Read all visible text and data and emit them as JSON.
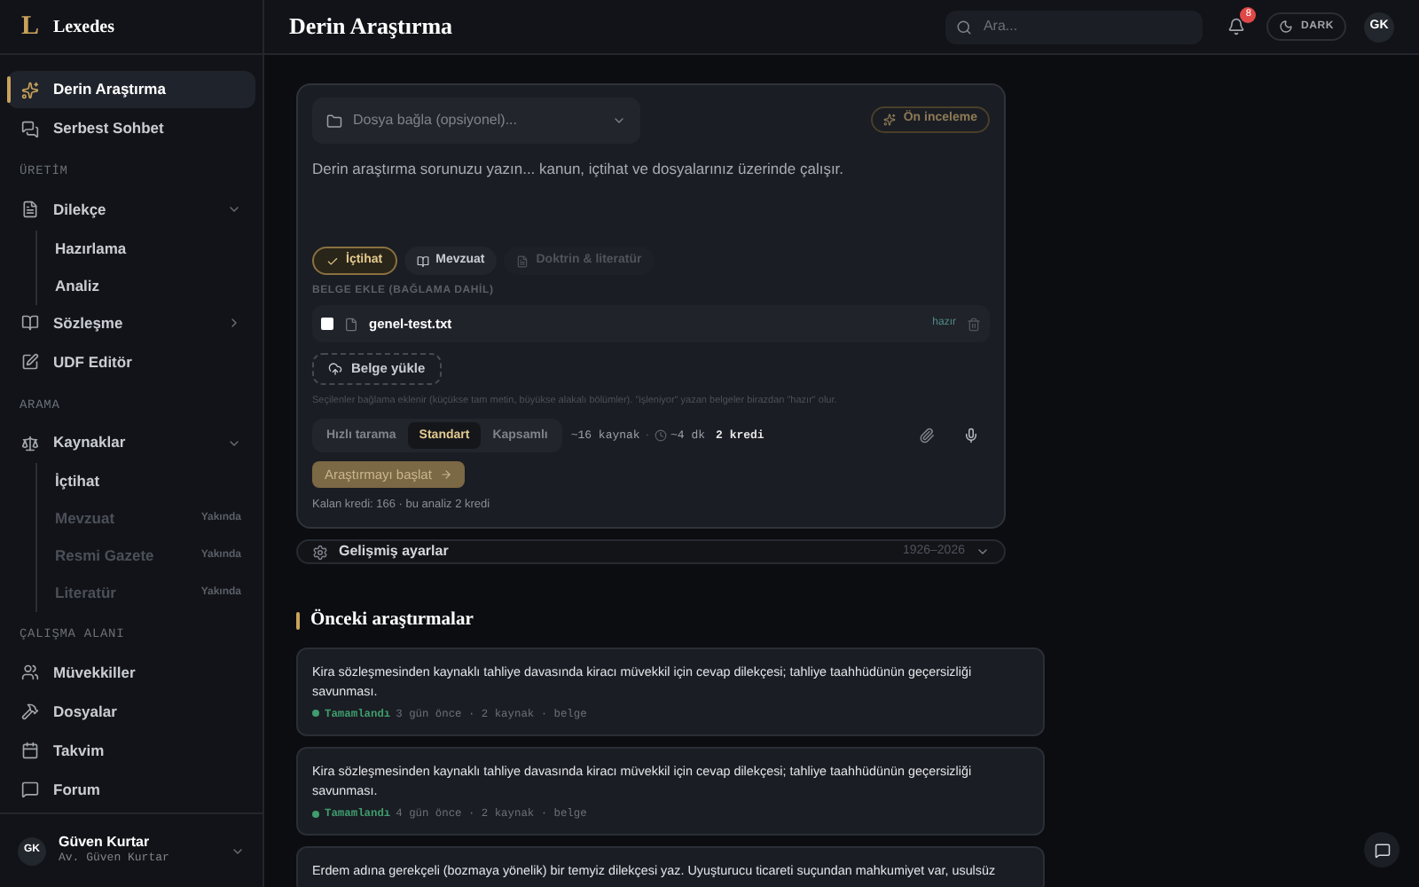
{
  "sidebar": {
    "logo": {
      "mark": "L",
      "name": "Lexedes"
    },
    "groups": [
      {
        "items": [
          {
            "label": "Derin Araştırma",
            "selected": true
          },
          {
            "label": "Serbest Sohbet",
            "selected": false
          }
        ]
      },
      {
        "heading": "ÜRETİM",
        "items": [
          {
            "label": "Dilekçe",
            "selected": false,
            "expanded": true,
            "children": [
              {
                "label": "Hazırlama",
                "disabled": false
              },
              {
                "label": "Analiz",
                "disabled": false
              }
            ]
          },
          {
            "label": "Sözleşme",
            "selected": false,
            "expanded": false
          },
          {
            "label": "UDF Editör",
            "selected": false
          }
        ]
      },
      {
        "heading": "ARAMA",
        "items": [
          {
            "label": "Kaynaklar",
            "selected": false,
            "expanded": true,
            "children": [
              {
                "label": "İçtihat",
                "disabled": false
              },
              {
                "label": "Mevzuat",
                "disabled": true,
                "badge": "Yakında"
              },
              {
                "label": "Resmi Gazete",
                "disabled": true,
                "badge": "Yakında"
              },
              {
                "label": "Literatür",
                "disabled": true,
                "badge": "Yakında"
              }
            ]
          }
        ]
      },
      {
        "heading": "ÇALIŞMA ALANI",
        "items": [
          {
            "label": "Müvekkiller",
            "selected": false
          },
          {
            "label": "Dosyalar",
            "selected": false
          },
          {
            "label": "Takvim",
            "selected": false
          },
          {
            "label": "Forum",
            "selected": false
          }
        ]
      }
    ],
    "user": {
      "initials": "GK",
      "name": "Güven Kurtar",
      "subtitle": "Av. Güven Kurtar"
    }
  },
  "header": {
    "title": "Derin Araştırma",
    "search": {
      "placeholder": "Ara..."
    },
    "notifications": "8",
    "theme": "DARK",
    "avatar": "GK"
  },
  "composer": {
    "attach": {
      "placeholder": "Dosya bağla (opsiyonel)..."
    },
    "preview": "Ön inceleme",
    "prompt": {
      "placeholder": "Derin araştırma sorunuzu yazın... kanun, içtihat ve dosyalarınız üzerinde çalışır."
    },
    "sources": [
      {
        "label": "İçtihat",
        "selected": true,
        "disabled": false
      },
      {
        "label": "Mevzuat",
        "selected": false,
        "disabled": false
      },
      {
        "label": "Doktrin & literatür",
        "selected": false,
        "disabled": true
      }
    ],
    "documents_heading": "BELGE EKLE (BAĞLAMA DAHİL)",
    "documents": [
      {
        "name": "genel-test.txt",
        "checked": false,
        "status": "hazır"
      }
    ],
    "upload": "Belge yükle",
    "hint": "Seçilenler bağlama eklenir (küçükse tam metin, büyükse alakalı bölümler). \"işleniyor\" yazan belgeler birazdan \"hazır\" olur.",
    "depth": [
      {
        "label": "Hızlı tarama",
        "selected": false
      },
      {
        "label": "Standart",
        "selected": true
      },
      {
        "label": "Kapsamlı",
        "selected": false
      }
    ],
    "estimate": {
      "sources": "~16 kaynak",
      "separator": "·",
      "time": "~4 dk",
      "cost": "2 kredi"
    },
    "start": "Araştırmayı başlat",
    "credits": "Kalan kredi: 166 · bu analiz 2 kredi"
  },
  "advanced": {
    "label": "Gelişmiş ayarlar",
    "range": "1926–2026",
    "expanded": false
  },
  "history": {
    "title": "Önceki araştırmalar",
    "items": [
      {
        "text": "Kira sözleşmesinden kaynaklı tahliye davasında kiracı müvekkil için cevap dilekçesi; tahliye taahhüdünün geçersizliği savunması.",
        "status": "Tamamlandı",
        "color": "#3f9d6e",
        "meta": "3 gün önce · 2 kaynak · belge"
      },
      {
        "text": "Kira sözleşmesinden kaynaklı tahliye davasında kiracı müvekkil için cevap dilekçesi; tahliye taahhüdünün geçersizliği savunması.",
        "status": "Tamamlandı",
        "color": "#3f9d6e",
        "meta": "4 gün önce · 2 kaynak · belge"
      },
      {
        "text": "Erdem adına gerekçeli (bozmaya yönelik) bir temyiz dilekçesi yaz. Uyuşturucu ticareti suçundan mahkumiyet var, usulsüz"
      }
    ]
  }
}
